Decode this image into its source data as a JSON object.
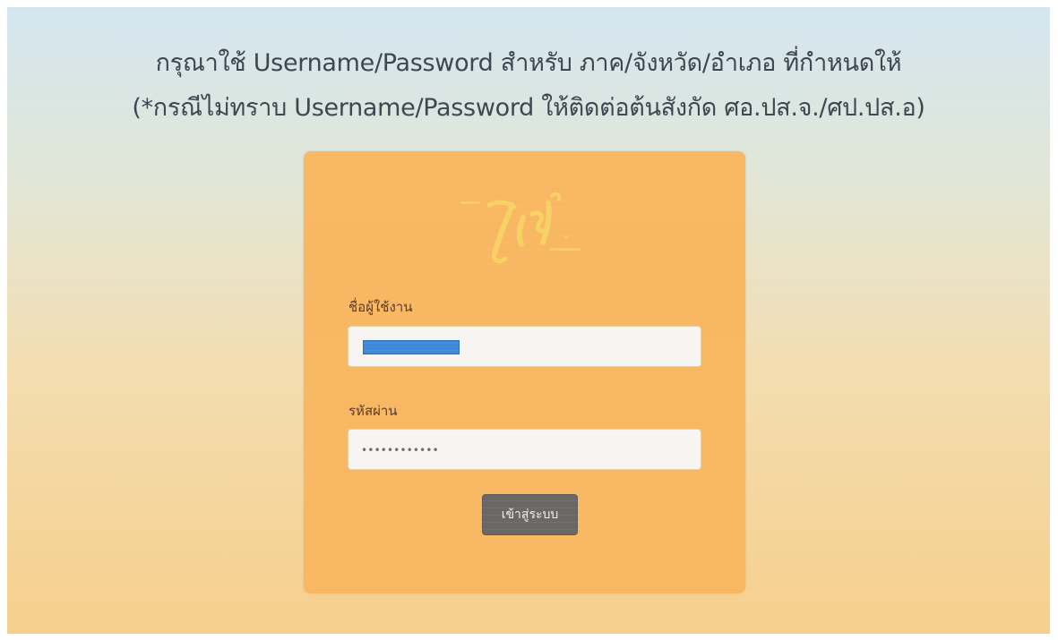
{
  "instructions": {
    "line1": "กรุณาใช้ Username/Password สำหรับ ภาค/จังหวัด/อำเภอ ที่กำหนดให้",
    "line2": "(*กรณีไม่ทราบ Username/Password ให้ติดต่อต้นสังกัด ศอ.ปส.จ./ศป.ปส.อ)"
  },
  "login": {
    "logo_icon": "ying-logo",
    "username_label": "ชื่อผู้ใช้งาน",
    "username_value": "",
    "password_label": "รหัสผ่าน",
    "password_mask": "••••••••••••",
    "submit_label": "เข้าสู่ระบบ"
  },
  "colors": {
    "card": "#f7b763",
    "button": "#6b6767",
    "redaction": "#3f8ad8"
  }
}
